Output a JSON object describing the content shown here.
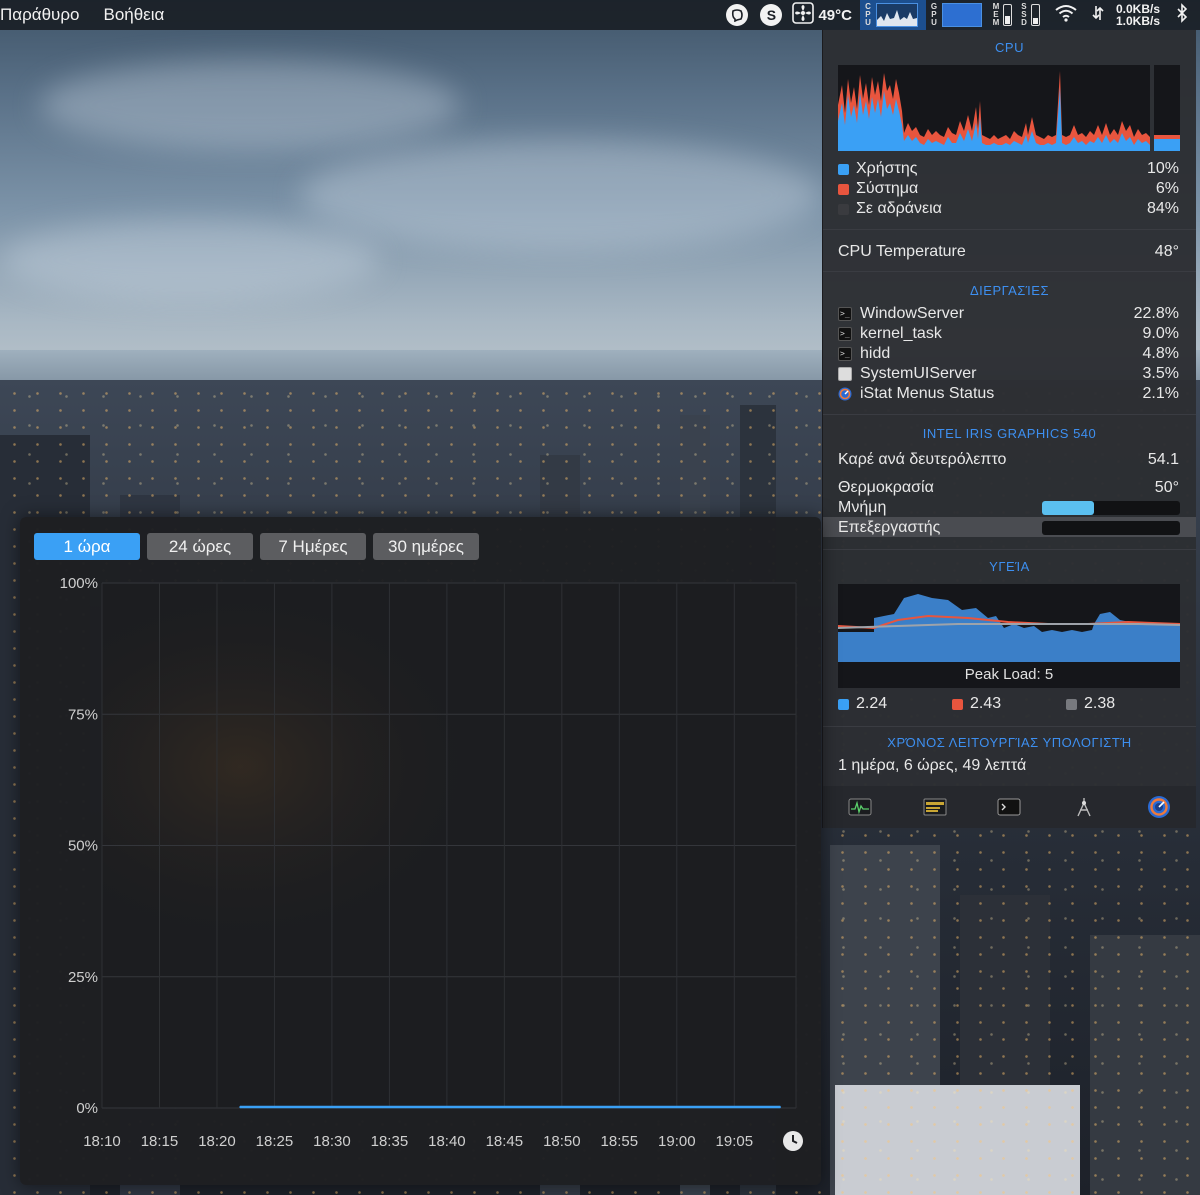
{
  "menubar": {
    "menus": [
      "Παράθυρο",
      "Βοήθεια"
    ],
    "temperature": "49°C",
    "cpu_label": [
      "C",
      "P",
      "U"
    ],
    "gpu_label": [
      "G",
      "P",
      "U"
    ],
    "mem_label": [
      "M",
      "E",
      "M"
    ],
    "ssd_label": [
      "S",
      "S",
      "D"
    ],
    "net_up": "0.0KB/s",
    "net_down": "1.0KB/s",
    "icons": [
      "viber-icon",
      "skype-icon",
      "fan-icon",
      "wifi-icon",
      "network-arrows-icon",
      "bluetooth-icon"
    ]
  },
  "cpu": {
    "title": "CPU",
    "rows": [
      {
        "label": "Χρήστης",
        "value": "10%",
        "color": "#3aa0f5"
      },
      {
        "label": "Σύστημα",
        "value": "6%",
        "color": "#e8553e"
      },
      {
        "label": "Σε αδράνεια",
        "value": "84%",
        "color": "#3a3b3f"
      }
    ],
    "temp_label": "CPU Temperature",
    "temp_value": "48°"
  },
  "processes": {
    "title": "ΔΙΕΡΓΑΣΊΕΣ",
    "items": [
      {
        "name": "WindowServer",
        "value": "22.8%"
      },
      {
        "name": "kernel_task",
        "value": "9.0%"
      },
      {
        "name": "hidd",
        "value": "4.8%"
      },
      {
        "name": "SystemUIServer",
        "value": "3.5%"
      },
      {
        "name": "iStat Menus Status",
        "value": "2.1%"
      }
    ]
  },
  "gpu": {
    "title": "INTEL IRIS GRAPHICS 540",
    "fps_label": "Καρέ ανά δευτερόλεπτο",
    "fps_value": "54.1",
    "temp_label": "Θερμοκρασία",
    "temp_value": "50°",
    "memory_label": "Μνήμη",
    "memory_fraction": 0.38,
    "processor_label": "Επεξεργαστής",
    "processor_fraction": 0.0
  },
  "health": {
    "title": "ΥΓΕΊΑ",
    "peak_load": "Peak Load: 5",
    "loads": [
      {
        "value": "2.24",
        "color": "#3aa0f5"
      },
      {
        "value": "2.43",
        "color": "#e8553e"
      },
      {
        "value": "2.38",
        "color": "#77797e"
      }
    ]
  },
  "uptime": {
    "title": "ΧΡΌΝΟΣ ΛΕΙΤΟΥΡΓΊΑΣ ΥΠΟΛΟΓΙΣΤΉ",
    "value": "1 ημέρα, 6 ώρες, 49 λεπτά"
  },
  "footer": {
    "icons": [
      "activity-monitor-icon",
      "console-icon",
      "terminal-icon",
      "system-preferences-icon",
      "istat-menus-icon"
    ]
  },
  "history": {
    "tabs": [
      {
        "label": "1 ώρα",
        "active": true
      },
      {
        "label": "24 ώρες",
        "active": false
      },
      {
        "label": "7 Ημέρες",
        "active": false
      },
      {
        "label": "30 ημέρες",
        "active": false
      }
    ],
    "clock_icon": "clock-icon"
  },
  "chart_data": {
    "type": "line",
    "title": "",
    "xlabel": "",
    "ylabel": "",
    "ylim": [
      0,
      100
    ],
    "y_ticks": [
      "100%",
      "75%",
      "50%",
      "25%",
      "0%"
    ],
    "x_ticks": [
      "18:10",
      "18:15",
      "18:20",
      "18:25",
      "18:30",
      "18:35",
      "18:40",
      "18:45",
      "18:50",
      "18:55",
      "19:00",
      "19:05"
    ],
    "series": [
      {
        "color": "#3aa0f5",
        "x": [
          "18:22",
          "18:25",
          "18:30",
          "18:35",
          "18:40",
          "18:45",
          "18:50",
          "18:55",
          "19:00",
          "19:05",
          "19:09"
        ],
        "values": [
          0,
          0,
          0,
          0,
          0,
          0,
          0,
          0,
          0,
          0,
          0
        ]
      }
    ],
    "grid": true
  }
}
